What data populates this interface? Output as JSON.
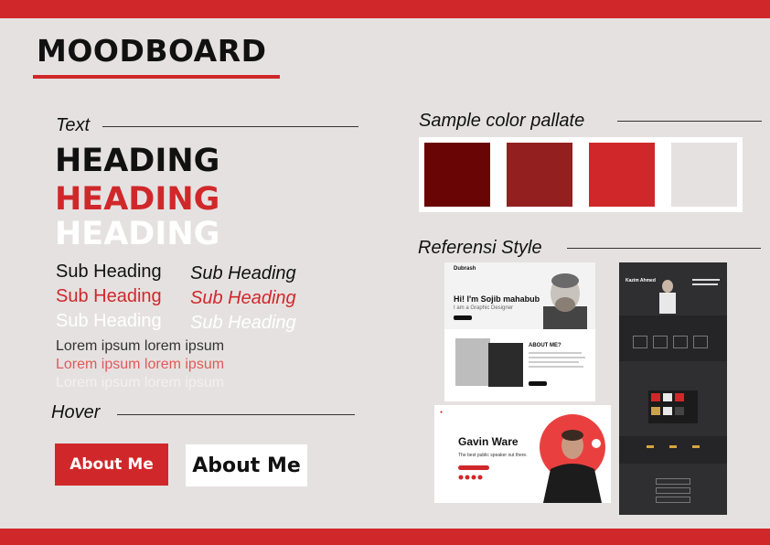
{
  "title": "MOODBOARD",
  "colors": {
    "brand_red": "#d0282a",
    "background": "#e6e1e1",
    "dark": "#111111"
  },
  "text_section": {
    "label": "Text",
    "headings": [
      "HEADING",
      "HEADING",
      "HEADING"
    ],
    "sub_headings": [
      "Sub Heading",
      "Sub Heading",
      "Sub Heading"
    ],
    "sub_headings_italic": [
      "Sub Heading",
      "Sub Heading",
      "Sub Heading"
    ],
    "lorem": [
      "Lorem ipsum lorem ipsum",
      "Lorem ipsum lorem ipsum",
      "Lorem ipsum lorem ipsum"
    ]
  },
  "hover_section": {
    "label": "Hover",
    "button_primary": "About Me",
    "button_secondary": "About Me"
  },
  "palette_section": {
    "label": "Sample color pallate",
    "swatches": [
      "#6a0505",
      "#93201f",
      "#d0282a",
      "#e6e1e1"
    ]
  },
  "reference_section": {
    "label": "Referensi Style",
    "ref1": {
      "logo": "Dubrash",
      "hero_title": "Hi! I'm Sojib mahabub",
      "hero_sub": "I am a Graphic Designer",
      "about_title": "ABOUT ME?"
    },
    "ref2": {
      "name": "Gavin Ware",
      "tagline": "The best public speaker out there."
    },
    "ref3": {
      "name": "Kazim Ahmed"
    }
  }
}
